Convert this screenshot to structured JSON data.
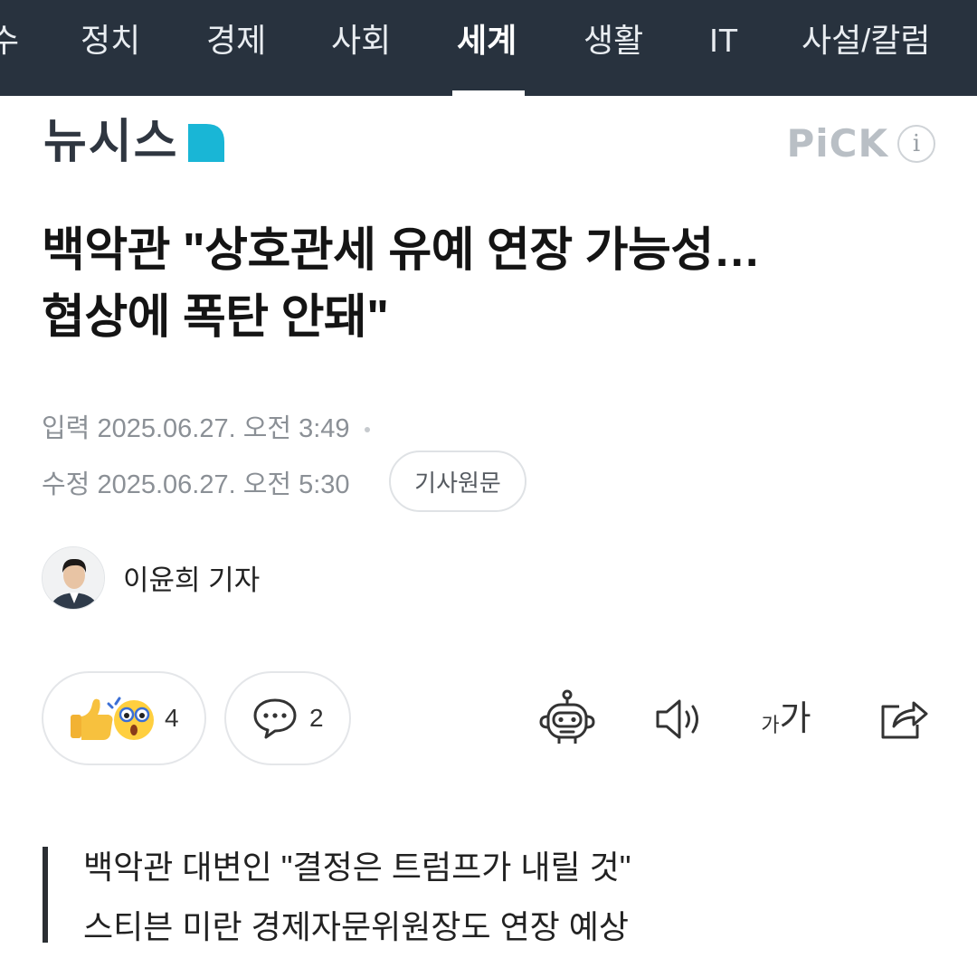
{
  "nav": {
    "tabs": [
      {
        "label": "수",
        "active": false
      },
      {
        "label": "정치",
        "active": false
      },
      {
        "label": "경제",
        "active": false
      },
      {
        "label": "사회",
        "active": false
      },
      {
        "label": "세계",
        "active": true
      },
      {
        "label": "생활",
        "active": false
      },
      {
        "label": "IT",
        "active": false
      },
      {
        "label": "사설/칼럼",
        "active": false
      }
    ]
  },
  "header": {
    "publisher": "뉴시스",
    "pick_label": "PiCK",
    "info_icon": "i"
  },
  "article": {
    "headline_line1": "백악관 \"상호관세 유예 연장 가능성…",
    "headline_line2": "협상에 폭탄 안돼\"",
    "input_label": "입력",
    "input_time": "2025.06.27. 오전 3:49",
    "edit_label": "수정",
    "edit_time": "2025.06.27. 오전 5:30",
    "original_button": "기사원문",
    "reporter": "이윤희 기자"
  },
  "actions": {
    "reaction_count": "4",
    "comment_count": "2",
    "font_size_small": "가",
    "font_size_large": "가"
  },
  "summary": {
    "line1": "백악관 대변인 \"결정은 트럼프가 내릴 것\"",
    "line2": "스티븐 미란 경제자문위원장도 연장 예상"
  },
  "colors": {
    "nav_bg": "#28323e",
    "logo_accent": "#19b6d6",
    "text_primary": "#141414",
    "text_meta": "#8b9096"
  },
  "icons": {
    "reaction": "thumbs-up-and-surprised-emoji-icon",
    "comment": "speech-bubble-icon",
    "robot": "ai-summary-robot-icon",
    "speaker": "text-to-speech-icon",
    "font": "font-size-icon",
    "share": "share-icon"
  }
}
